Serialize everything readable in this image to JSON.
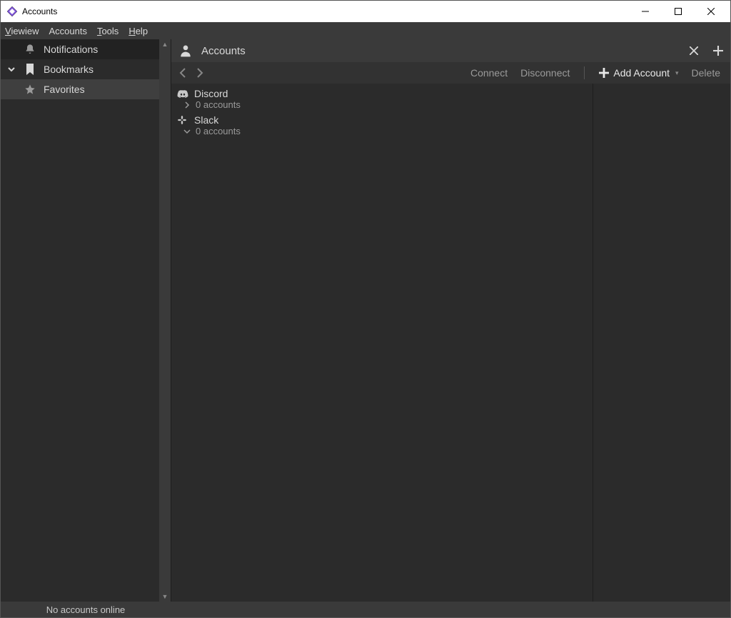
{
  "window": {
    "title": "Accounts"
  },
  "menubar": {
    "items": [
      "View",
      "Accounts",
      "Tools",
      "Help"
    ]
  },
  "sidebar": {
    "items": [
      {
        "label": "Notifications",
        "icon": "bell-icon",
        "expandable": false
      },
      {
        "label": "Bookmarks",
        "icon": "bookmark-icon",
        "expandable": true
      },
      {
        "label": "Favorites",
        "icon": "star-icon",
        "expandable": false,
        "selected": true
      }
    ]
  },
  "content": {
    "title": "Accounts",
    "toolbar": {
      "connect": "Connect",
      "disconnect": "Disconnect",
      "add_account": "Add Account",
      "delete": "Delete"
    },
    "services": [
      {
        "name": "Discord",
        "subtitle": "0 accounts",
        "expanded": false
      },
      {
        "name": "Slack",
        "subtitle": "0 accounts",
        "expanded": true
      }
    ]
  },
  "statusbar": {
    "text": "No accounts online"
  }
}
